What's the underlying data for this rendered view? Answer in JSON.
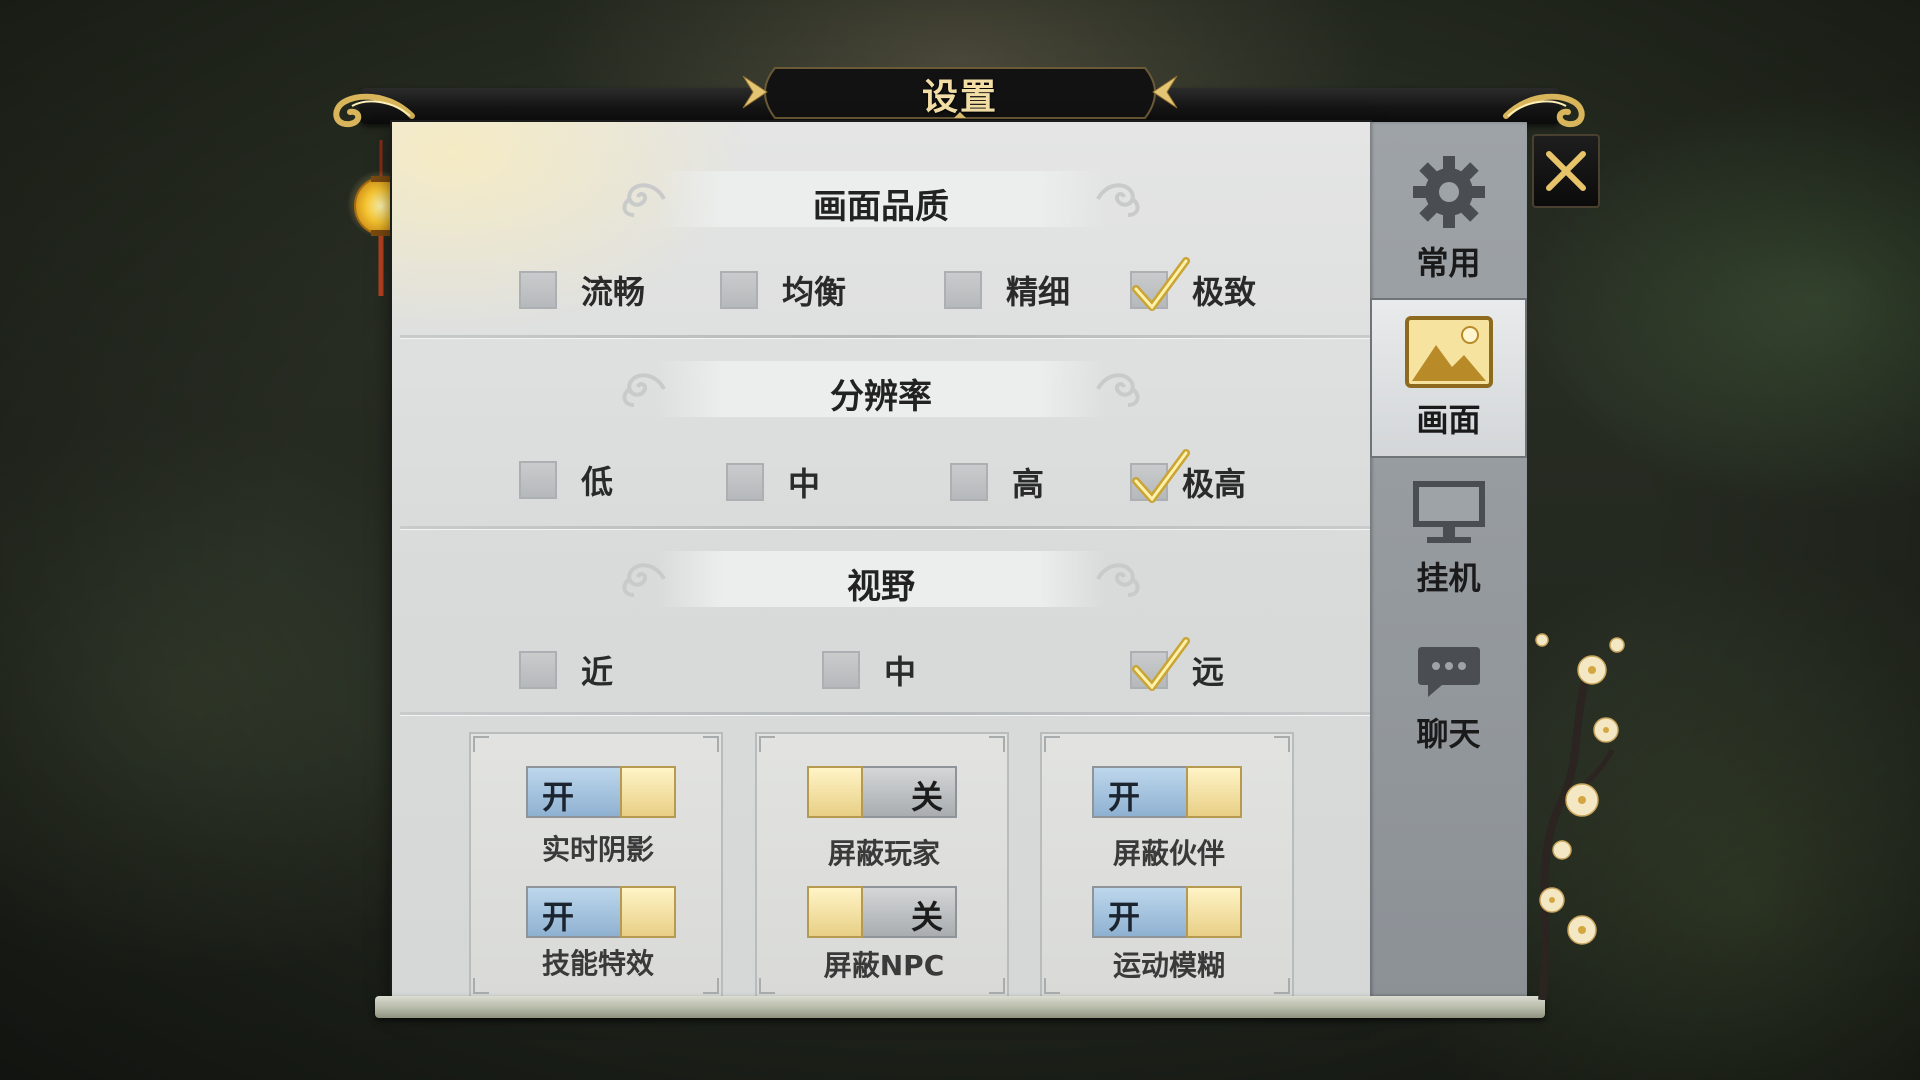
{
  "title": "设置",
  "close_icon": "close-icon",
  "sidebar": {
    "tabs": [
      {
        "label": "常用",
        "icon": "gear-icon",
        "active": false
      },
      {
        "label": "画面",
        "icon": "picture-icon",
        "active": true
      },
      {
        "label": "挂机",
        "icon": "monitor-icon",
        "active": false
      },
      {
        "label": "聊天",
        "icon": "chat-bubble-icon",
        "active": false
      }
    ]
  },
  "sections": [
    {
      "title": "画面品质",
      "options": [
        {
          "label": "流畅",
          "checked": false
        },
        {
          "label": "均衡",
          "checked": false
        },
        {
          "label": "精细",
          "checked": false
        },
        {
          "label": "极致",
          "checked": true
        }
      ]
    },
    {
      "title": "分辨率",
      "options": [
        {
          "label": "低",
          "checked": false
        },
        {
          "label": "中",
          "checked": false
        },
        {
          "label": "高",
          "checked": false
        },
        {
          "label": "极高",
          "checked": true
        }
      ]
    },
    {
      "title": "视野",
      "options": [
        {
          "label": "近",
          "checked": false
        },
        {
          "label": "中",
          "checked": false
        },
        {
          "label": "远",
          "checked": true
        }
      ]
    }
  ],
  "toggles": [
    {
      "label": "实时阴影",
      "state": "开",
      "on": true
    },
    {
      "label": "技能特效",
      "state": "开",
      "on": true
    },
    {
      "label": "屏蔽玩家",
      "state": "关",
      "on": false
    },
    {
      "label": "屏蔽NPC",
      "state": "关",
      "on": false
    },
    {
      "label": "屏蔽伙伴",
      "state": "开",
      "on": true
    },
    {
      "label": "运动模糊",
      "state": "开",
      "on": true
    }
  ],
  "colors": {
    "gold": "#f3dfa6",
    "toggle_on": "#8fb1d1",
    "toggle_knob": "#e8cf86",
    "panel": "#d9dbdb"
  }
}
